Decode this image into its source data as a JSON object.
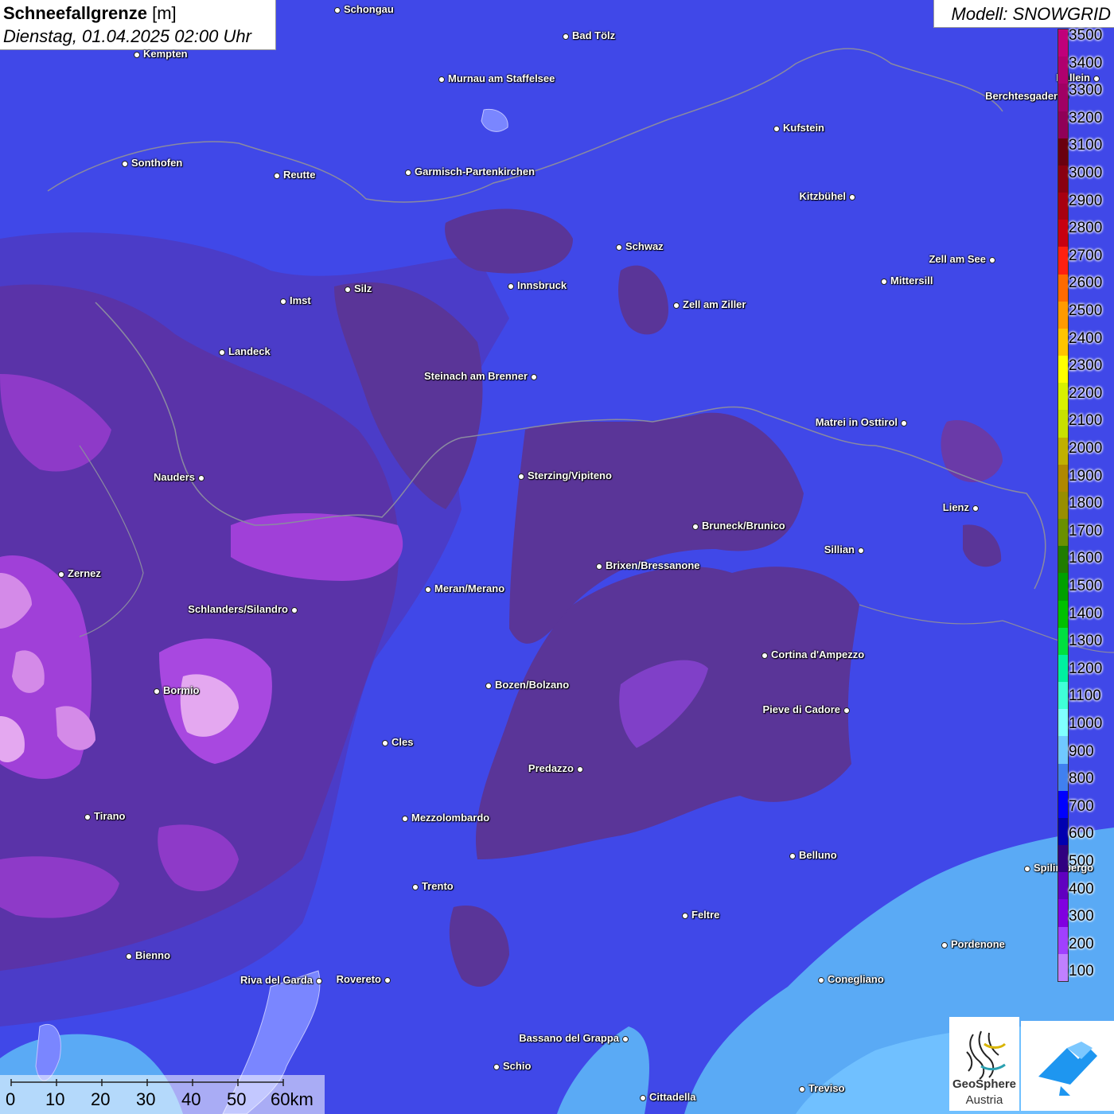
{
  "header": {
    "title": "Schneefallgrenze",
    "unit": "[m]",
    "datetime": "Dienstag, 01.04.2025 02:00 Uhr",
    "model": "Modell: SNOWGRID"
  },
  "legend": {
    "ticks": [
      "3500",
      "3400",
      "3300",
      "3200",
      "3100",
      "3000",
      "2900",
      "2800",
      "2700",
      "2600",
      "2500",
      "2400",
      "2300",
      "2200",
      "2100",
      "2000",
      "1900",
      "1800",
      "1700",
      "1600",
      "1500",
      "1400",
      "1300",
      "1200",
      "1100",
      "1000",
      "900",
      "800",
      "700",
      "600",
      "500",
      "400",
      "300",
      "200",
      "100"
    ],
    "colors": [
      "#c0007a",
      "#b0006e",
      "#a00064",
      "#900058",
      "#6a0010",
      "#8a0010",
      "#a80010",
      "#c80010",
      "#ff2010",
      "#ff6a00",
      "#ff9a00",
      "#ffc400",
      "#ffff00",
      "#d8f000",
      "#c8e000",
      "#c0b000",
      "#b08800",
      "#988e00",
      "#6a9000",
      "#207c00",
      "#00a000",
      "#00c000",
      "#00e040",
      "#00f0a0",
      "#40ffd8",
      "#80ffff",
      "#70c8ff",
      "#4080f0",
      "#0000ff",
      "#0000b0",
      "#300080",
      "#6000c0",
      "#8000e0",
      "#a040ff",
      "#c080ff"
    ]
  },
  "scale": {
    "labels": [
      "0",
      "10",
      "20",
      "30",
      "40",
      "50",
      "60km"
    ]
  },
  "cities": [
    {
      "name": "Schongau"
    },
    {
      "name": "Kempten"
    },
    {
      "name": "Bad Tölz"
    },
    {
      "name": "Murnau am Staffelsee"
    },
    {
      "name": "Berchtesgaden"
    },
    {
      "name": "Hallein"
    },
    {
      "name": "Kufstein"
    },
    {
      "name": "Sonthofen"
    },
    {
      "name": "Reutte"
    },
    {
      "name": "Garmisch-Partenkirchen"
    },
    {
      "name": "Kitzbühel"
    },
    {
      "name": "Schwaz"
    },
    {
      "name": "Zell am See"
    },
    {
      "name": "Innsbruck"
    },
    {
      "name": "Mittersill"
    },
    {
      "name": "Imst"
    },
    {
      "name": "Silz"
    },
    {
      "name": "Zell am Ziller"
    },
    {
      "name": "Landeck"
    },
    {
      "name": "Steinach am Brenner"
    },
    {
      "name": "Matrei in Osttirol"
    },
    {
      "name": "Nauders"
    },
    {
      "name": "Sterzing/Vipiteno"
    },
    {
      "name": "Lienz"
    },
    {
      "name": "Bruneck/Brunico"
    },
    {
      "name": "Sillian"
    },
    {
      "name": "Zernez"
    },
    {
      "name": "Brixen/Bressanone"
    },
    {
      "name": "Meran/Merano"
    },
    {
      "name": "Schlanders/Silandro"
    },
    {
      "name": "Cortina d'Ampezzo"
    },
    {
      "name": "Bozen/Bolzano"
    },
    {
      "name": "Bormio"
    },
    {
      "name": "Pieve di Cadore"
    },
    {
      "name": "Cles"
    },
    {
      "name": "Predazzo"
    },
    {
      "name": "Tirano"
    },
    {
      "name": "Mezzolombardo"
    },
    {
      "name": "Belluno"
    },
    {
      "name": "Spilimbergo"
    },
    {
      "name": "Trento"
    },
    {
      "name": "Feltre"
    },
    {
      "name": "Pordenone"
    },
    {
      "name": "Bienno"
    },
    {
      "name": "Riva del Garda"
    },
    {
      "name": "Rovereto"
    },
    {
      "name": "Conegliano"
    },
    {
      "name": "Bassano del Grappa"
    },
    {
      "name": "Schio"
    },
    {
      "name": "Treviso"
    },
    {
      "name": "Cittadella"
    }
  ],
  "logos": {
    "geosphere_line1": "GeoSphere",
    "geosphere_line2": "Austria"
  },
  "colors": {
    "background_blue": "#3f45e8",
    "mid_purple": "#5a33a8",
    "dark_purple": "#5b2f7a",
    "magenta": "#a040d8",
    "light_magenta": "#d48ae8",
    "light_blue": "#5aaaf5",
    "sky_blue": "#70c0ff"
  }
}
